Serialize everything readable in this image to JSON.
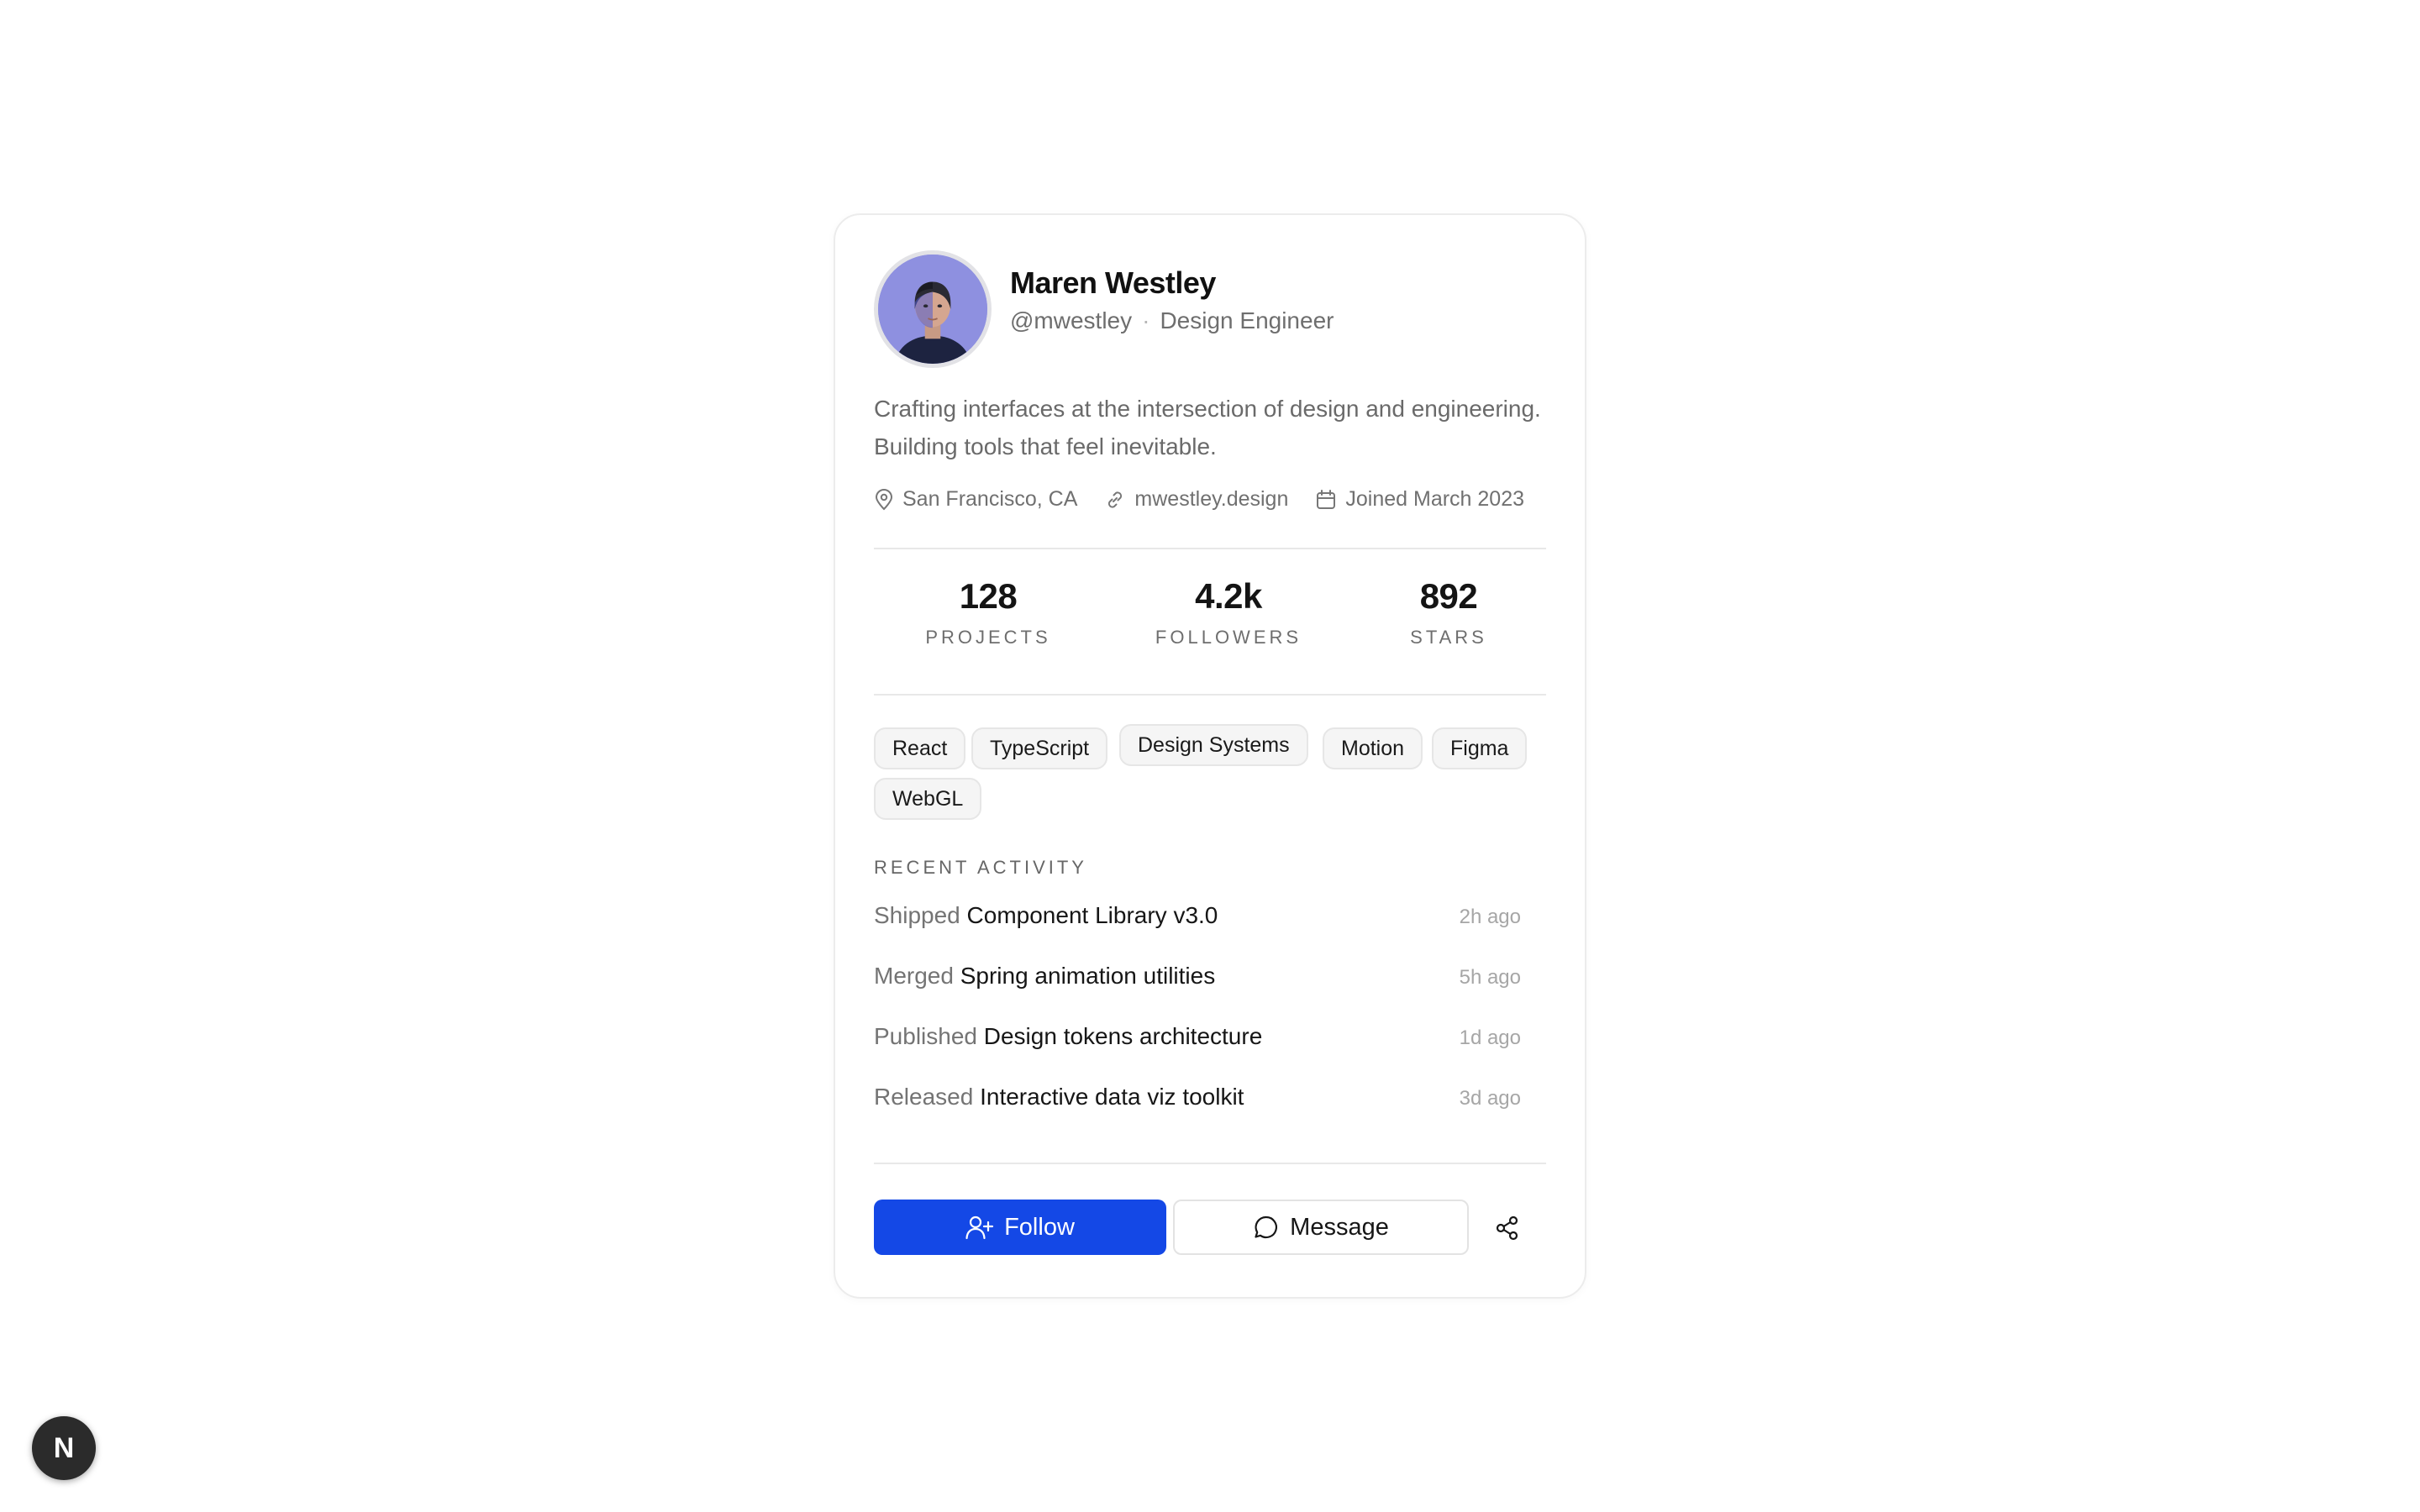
{
  "profile": {
    "name": "Maren Westley",
    "handle": "@mwestley",
    "separator": "·",
    "role": "Design Engineer",
    "bio": "Crafting interfaces at the intersection of design and engineering. Building tools that feel inevitable.",
    "avatar_icon": "person-portrait-avatar",
    "location": "San Francisco, CA",
    "website": "mwestley.design",
    "joined": "Joined March 2023",
    "location_icon": "map-pin-icon",
    "website_icon": "link-icon",
    "joined_icon": "calendar-icon"
  },
  "stats": [
    {
      "value": "128",
      "label": "PROJECTS"
    },
    {
      "value": "4.2k",
      "label": "FOLLOWERS"
    },
    {
      "value": "892",
      "label": "STARS"
    }
  ],
  "tags": [
    "React",
    "TypeScript",
    "Design Systems",
    "Motion",
    "Figma",
    "WebGL"
  ],
  "activity": {
    "title": "RECENT ACTIVITY",
    "items": [
      {
        "verb": "Shipped",
        "object": "Component Library v3.0",
        "time": "2h ago"
      },
      {
        "verb": "Merged",
        "object": "Spring animation utilities",
        "time": "5h ago"
      },
      {
        "verb": "Published",
        "object": "Design tokens architecture",
        "time": "1d ago"
      },
      {
        "verb": "Released",
        "object": "Interactive data viz toolkit",
        "time": "3d ago"
      }
    ]
  },
  "actions": {
    "follow_label": "Follow",
    "message_label": "Message",
    "follow_icon": "user-plus-icon",
    "message_icon": "chat-bubble-icon",
    "share_icon": "share-icon"
  },
  "badge": {
    "label": "N"
  },
  "colors": {
    "primary": "#1448e6",
    "avatar_bg": "#8e90e0"
  }
}
